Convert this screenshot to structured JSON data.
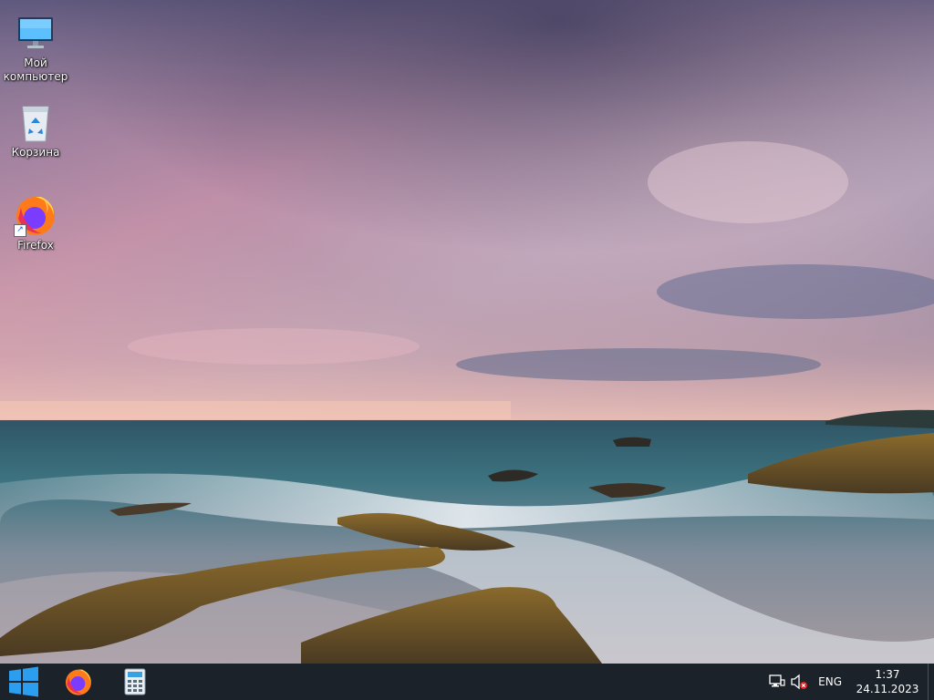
{
  "desktop": {
    "icons": [
      {
        "label": "Мой\nкомпьютер",
        "icon": "monitor-icon"
      },
      {
        "label": "Корзина",
        "icon": "recycle-bin-icon"
      },
      {
        "label": "Firefox",
        "icon": "firefox-icon",
        "shortcut": true
      }
    ]
  },
  "taskbar": {
    "start": {
      "icon": "windows-logo-icon"
    },
    "pinned": [
      {
        "icon": "firefox-icon"
      },
      {
        "icon": "calculator-icon"
      }
    ],
    "tray": {
      "network_icon": "network-icon",
      "volume_icon": "volume-muted-icon",
      "language": "ENG",
      "time": "1:37",
      "date": "24.11.2023"
    }
  },
  "colors": {
    "taskbar_bg": "#1c2229",
    "windows_blue": "#2b9ef0",
    "firefox_orange": "#ff7a1a",
    "firefox_purple": "#7a3cff"
  }
}
